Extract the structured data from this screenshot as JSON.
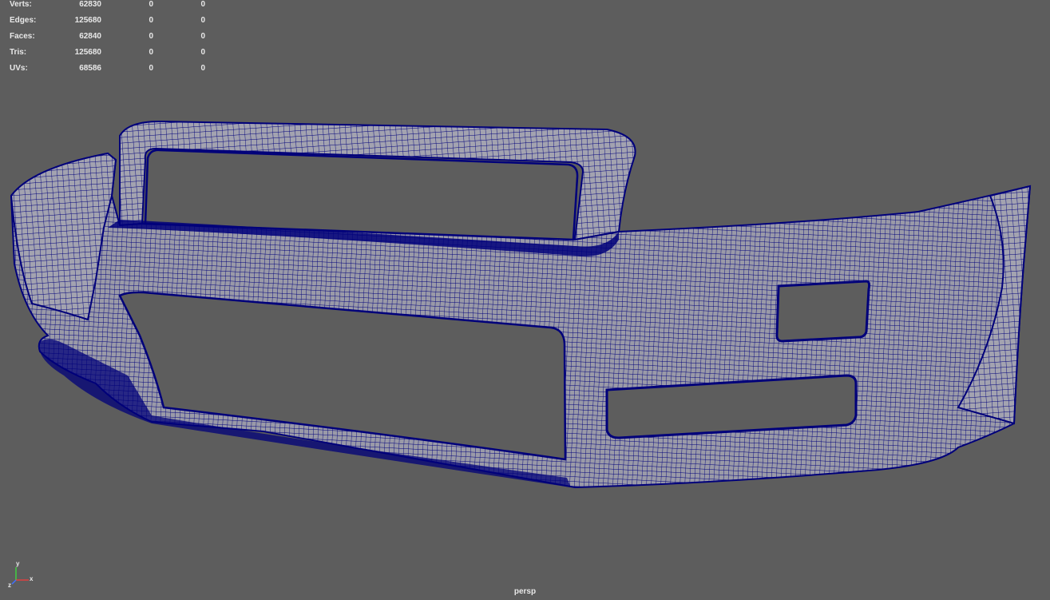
{
  "hud": {
    "rows": [
      {
        "label": "Verts:",
        "v0": "62830",
        "v1": "0",
        "v2": "0"
      },
      {
        "label": "Edges:",
        "v0": "125680",
        "v1": "0",
        "v2": "0"
      },
      {
        "label": "Faces:",
        "v0": "62840",
        "v1": "0",
        "v2": "0"
      },
      {
        "label": "Tris:",
        "v0": "125680",
        "v1": "0",
        "v2": "0"
      },
      {
        "label": "UVs:",
        "v0": "68586",
        "v1": "0",
        "v2": "0"
      }
    ]
  },
  "viewport": {
    "camera": "persp",
    "background_color": "#5d5d5d",
    "wire_color": "#00007a",
    "surface_color": "#9a9aa8"
  },
  "axis_gizmo": {
    "x_label": "x",
    "y_label": "y",
    "z_label": "z",
    "x_color": "#e04040",
    "y_color": "#40d040",
    "z_color": "#4070ff"
  }
}
